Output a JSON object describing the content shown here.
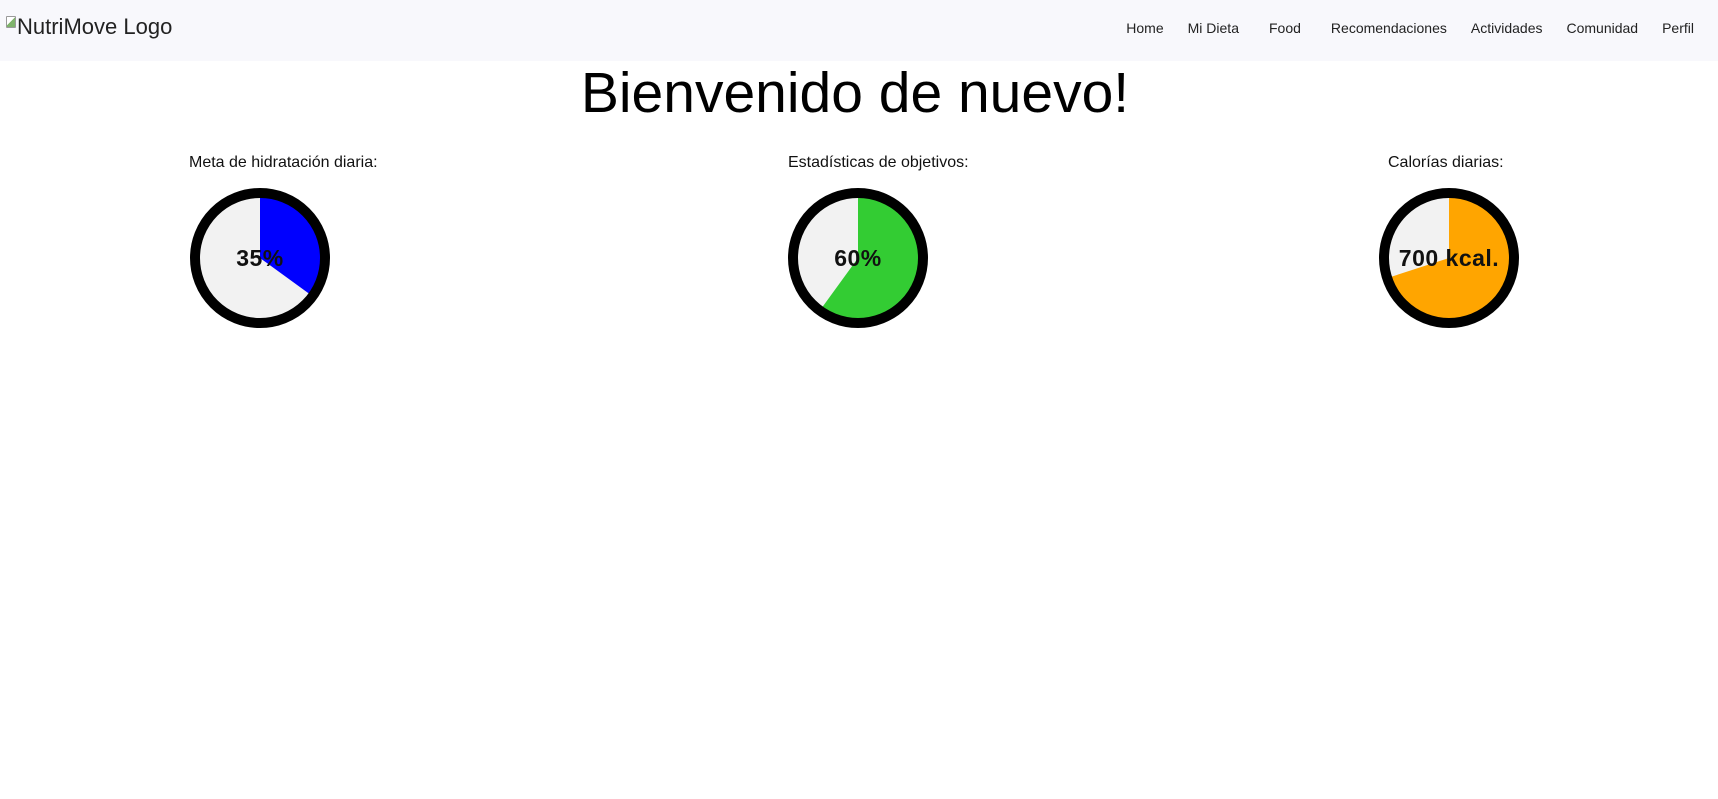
{
  "header": {
    "logo_alt": "NutriMove Logo",
    "nav": [
      {
        "label": "Home"
      },
      {
        "label": "Mi Dieta"
      },
      {
        "label": "Food"
      },
      {
        "label": "Recomendaciones"
      },
      {
        "label": "Actividades"
      },
      {
        "label": "Comunidad"
      },
      {
        "label": "Perfil"
      }
    ]
  },
  "main": {
    "title": "Bienvenido de nuevo!",
    "stats": [
      {
        "label": "Meta de hidratación diaria:",
        "value_text": "35%",
        "fraction": 0.35,
        "color": "#0000ff"
      },
      {
        "label": "Estadísticas de objetivos:",
        "value_text": "60%",
        "fraction": 0.6,
        "color": "#33cc33"
      },
      {
        "label": "Calorías diarias:",
        "value_text": "700 kcal.",
        "fraction": 0.7,
        "color": "#ffa500"
      }
    ]
  },
  "colors": {
    "gauge_track": "#f2f2f2",
    "gauge_border": "#000000",
    "navbar_bg": "#f8f8fc"
  },
  "icons": {
    "logo": "broken-image-icon"
  }
}
